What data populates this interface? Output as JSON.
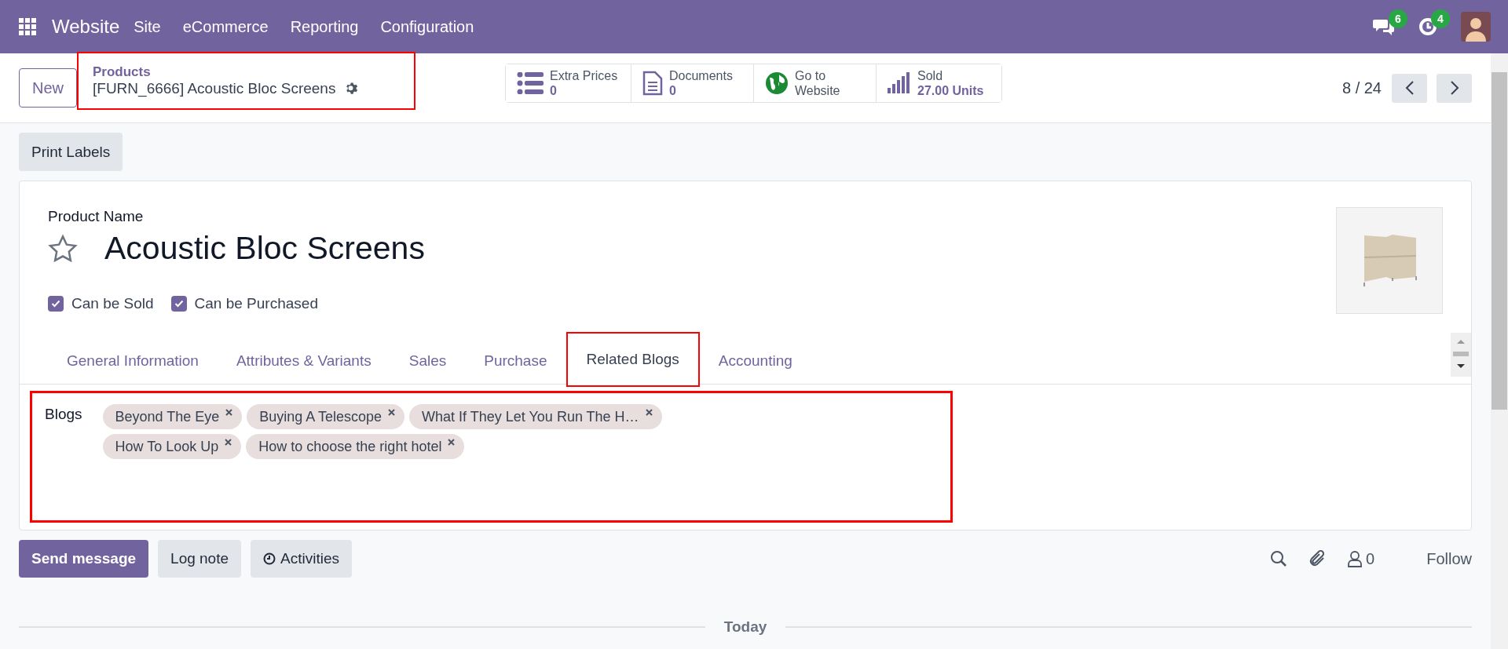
{
  "navbar": {
    "app": "Website",
    "menu": [
      "Site",
      "eCommerce",
      "Reporting",
      "Configuration"
    ],
    "message_count": "6",
    "activity_count": "4"
  },
  "control_panel": {
    "new_button": "New",
    "breadcrumb": {
      "parent": "Products",
      "current": "[FURN_6666] Acoustic Bloc Screens",
      "highlighted": true
    },
    "stat_buttons": [
      {
        "kind": "list",
        "label": "Extra Prices",
        "value": "0"
      },
      {
        "kind": "document",
        "label": "Documents",
        "value": "0"
      },
      {
        "kind": "globe",
        "label": "Go to",
        "value": "Website"
      },
      {
        "kind": "chart",
        "label": "Sold",
        "value": "27.00 Units"
      }
    ],
    "pager": "8 / 24"
  },
  "print_labels": "Print Labels",
  "form": {
    "field_label": "Product Name",
    "name": "Acoustic Bloc Screens",
    "favorite": false,
    "checkboxes": [
      {
        "label": "Can be Sold",
        "checked": true
      },
      {
        "label": "Can be Purchased",
        "checked": true
      }
    ],
    "tabs": [
      {
        "label": "General Information",
        "selected": false,
        "highlighted": false
      },
      {
        "label": "Attributes & Variants",
        "selected": false,
        "highlighted": false
      },
      {
        "label": "Sales",
        "selected": false,
        "highlighted": false
      },
      {
        "label": "Purchase",
        "selected": false,
        "highlighted": false
      },
      {
        "label": "Related Blogs",
        "selected": true,
        "highlighted": true
      },
      {
        "label": "Accounting",
        "selected": false,
        "highlighted": false
      }
    ],
    "blogs": {
      "label": "Blogs",
      "highlighted": true,
      "tags": [
        "Beyond The Eye",
        "Buying A Telescope",
        "What If They Let You Run The H…",
        "How To Look Up",
        "How to choose the right hotel"
      ]
    }
  },
  "chatter": {
    "buttons": [
      {
        "kind": "primary",
        "label": "Send message"
      },
      {
        "kind": "plain",
        "label": "Log note"
      },
      {
        "kind": "activities",
        "label": "Activities"
      }
    ],
    "follower_count": "0",
    "follow": "Follow",
    "divider": "Today"
  }
}
